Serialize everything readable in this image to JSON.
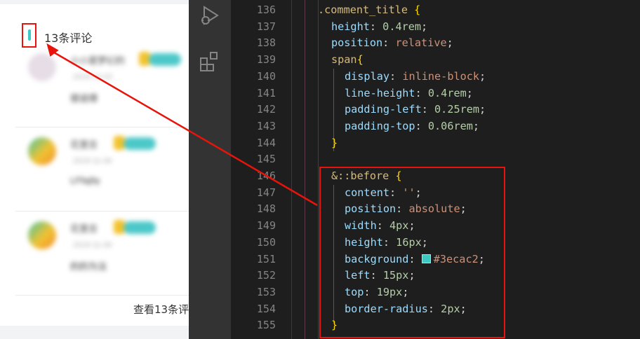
{
  "mobile": {
    "comment_title": "13条评论",
    "comments": [
      {
        "name": "小小是梦幻的",
        "time": "2019-12-02",
        "text": "很说得"
      },
      {
        "name": "花里吉",
        "time": "2019-11-06",
        "text": "LFfaj9y"
      },
      {
        "name": "花里吉",
        "time": "2019-11-06",
        "text": "的的为法"
      }
    ],
    "view_more": "查看13条评"
  },
  "activity_bar": {
    "icons": [
      "run-debug-icon",
      "extensions-icon"
    ]
  },
  "editor": {
    "line_numbers": [
      "136",
      "137",
      "138",
      "139",
      "140",
      "141",
      "142",
      "143",
      "144",
      "145",
      "146",
      "147",
      "148",
      "149",
      "150",
      "151",
      "152",
      "153",
      "154",
      "155"
    ],
    "lines": {
      "l136": {
        "selector": ".comment_title",
        "brace": "{"
      },
      "l137": {
        "prop": "height",
        "value": "0.4rem"
      },
      "l138": {
        "prop": "position",
        "value": "relative"
      },
      "l139": {
        "selector": "span",
        "brace": "{"
      },
      "l140": {
        "prop": "display",
        "value": "inline-block"
      },
      "l141": {
        "prop": "line-height",
        "value": "0.4rem"
      },
      "l142": {
        "prop": "padding-left",
        "value": "0.25rem"
      },
      "l143": {
        "prop": "padding-top",
        "value": "0.06rem"
      },
      "l144": {
        "brace": "}"
      },
      "l146": {
        "selector": "&::before",
        "brace": "{"
      },
      "l147": {
        "prop": "content",
        "value": "''"
      },
      "l148": {
        "prop": "position",
        "value": "absolute"
      },
      "l149": {
        "prop": "width",
        "value": "4px"
      },
      "l150": {
        "prop": "height",
        "value": "16px"
      },
      "l151": {
        "prop": "background",
        "value": "#3ecac2"
      },
      "l152": {
        "prop": "left",
        "value": "15px"
      },
      "l153": {
        "prop": "top",
        "value": "19px"
      },
      "l154": {
        "prop": "border-radius",
        "value": "2px"
      },
      "l155": {
        "brace": "}"
      }
    }
  },
  "colors": {
    "accent": "#3ecac2",
    "highlight_red": "#e8140c",
    "editor_bg": "#1e1e1e",
    "activity_bg": "#333333"
  }
}
